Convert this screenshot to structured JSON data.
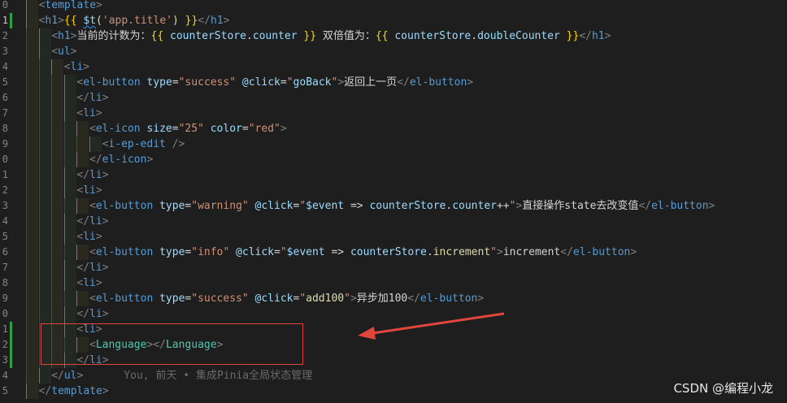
{
  "editor": {
    "line_numbers": [
      "0",
      "1",
      "2",
      "3",
      "4",
      "5",
      "6",
      "7",
      "8",
      "9",
      "0",
      "1",
      "2",
      "3",
      "4",
      "5",
      "6",
      "7",
      "8",
      "9",
      "0",
      "1",
      "2",
      "3",
      "4"
    ],
    "lines": [
      {
        "tokens": [
          [
            "t-punc",
            "<"
          ],
          [
            "t-tag",
            "template"
          ],
          [
            "t-punc",
            ">"
          ]
        ]
      },
      {
        "tokens": [
          [
            "t-punc",
            "<"
          ],
          [
            "t-tag",
            "h1"
          ],
          [
            "t-punc",
            ">"
          ],
          [
            "t-brace",
            "{{ "
          ],
          [
            "t-dollar",
            "$t"
          ],
          [
            "t-fn",
            "("
          ],
          [
            "t-str",
            "'app.title'"
          ],
          [
            "t-fn",
            ")"
          ],
          [
            "t-brace",
            " }}"
          ],
          [
            "t-punc",
            "</"
          ],
          [
            "t-tag",
            "h1"
          ],
          [
            "t-punc",
            ">"
          ]
        ]
      },
      {
        "tokens": [
          [
            "t-punc",
            "<"
          ],
          [
            "t-tag",
            "h1"
          ],
          [
            "t-punc",
            ">"
          ],
          [
            "t-text",
            "当前的计数为："
          ],
          [
            "t-brace",
            "{{ "
          ],
          [
            "t-var",
            "counterStore"
          ],
          [
            "t-op",
            "."
          ],
          [
            "t-var",
            "counter"
          ],
          [
            "t-brace",
            " }}"
          ],
          [
            "t-text",
            " 双倍值为："
          ],
          [
            "t-brace",
            "{{ "
          ],
          [
            "t-var",
            "counterStore"
          ],
          [
            "t-op",
            "."
          ],
          [
            "t-var",
            "doubleCounter"
          ],
          [
            "t-brace",
            " }}"
          ],
          [
            "t-punc",
            "</"
          ],
          [
            "t-tag",
            "h1"
          ],
          [
            "t-punc",
            ">"
          ]
        ]
      },
      {
        "tokens": [
          [
            "t-punc",
            "<"
          ],
          [
            "t-tag",
            "ul"
          ],
          [
            "t-punc",
            ">"
          ]
        ]
      },
      {
        "tokens": [
          [
            "t-punc",
            "<"
          ],
          [
            "t-tag",
            "li"
          ],
          [
            "t-punc",
            ">"
          ]
        ]
      },
      {
        "tokens": [
          [
            "t-punc",
            "<"
          ],
          [
            "t-tag",
            "el-button"
          ],
          [
            "t-text",
            " "
          ],
          [
            "t-attr",
            "type"
          ],
          [
            "t-text",
            "="
          ],
          [
            "t-str",
            "\"success\""
          ],
          [
            "t-text",
            " "
          ],
          [
            "t-attr",
            "@click"
          ],
          [
            "t-text",
            "="
          ],
          [
            "t-str",
            "\""
          ],
          [
            "t-var",
            "goBack"
          ],
          [
            "t-str",
            "\""
          ],
          [
            "t-punc",
            ">"
          ],
          [
            "t-text",
            "返回上一页"
          ],
          [
            "t-punc",
            "</"
          ],
          [
            "t-tag",
            "el-button"
          ],
          [
            "t-punc",
            ">"
          ]
        ]
      },
      {
        "tokens": [
          [
            "t-punc",
            "</"
          ],
          [
            "t-tag",
            "li"
          ],
          [
            "t-punc",
            ">"
          ]
        ]
      },
      {
        "tokens": [
          [
            "t-punc",
            "<"
          ],
          [
            "t-tag",
            "li"
          ],
          [
            "t-punc",
            ">"
          ]
        ]
      },
      {
        "tokens": [
          [
            "t-punc",
            "<"
          ],
          [
            "t-tag",
            "el-icon"
          ],
          [
            "t-text",
            " "
          ],
          [
            "t-attr",
            "size"
          ],
          [
            "t-text",
            "="
          ],
          [
            "t-str",
            "\"25\""
          ],
          [
            "t-text",
            " "
          ],
          [
            "t-attr",
            "color"
          ],
          [
            "t-text",
            "="
          ],
          [
            "t-str",
            "\"red\""
          ],
          [
            "t-punc",
            ">"
          ]
        ]
      },
      {
        "tokens": [
          [
            "t-punc",
            "<"
          ],
          [
            "t-tag",
            "i-ep-edit"
          ],
          [
            "t-text",
            " "
          ],
          [
            "t-punc",
            "/>"
          ]
        ]
      },
      {
        "tokens": [
          [
            "t-punc",
            "</"
          ],
          [
            "t-tag",
            "el-icon"
          ],
          [
            "t-punc",
            ">"
          ]
        ]
      },
      {
        "tokens": [
          [
            "t-punc",
            "</"
          ],
          [
            "t-tag",
            "li"
          ],
          [
            "t-punc",
            ">"
          ]
        ]
      },
      {
        "tokens": [
          [
            "t-punc",
            "<"
          ],
          [
            "t-tag",
            "li"
          ],
          [
            "t-punc",
            ">"
          ]
        ]
      },
      {
        "tokens": [
          [
            "t-punc",
            "<"
          ],
          [
            "t-tag",
            "el-button"
          ],
          [
            "t-text",
            " "
          ],
          [
            "t-attr",
            "type"
          ],
          [
            "t-text",
            "="
          ],
          [
            "t-str",
            "\"warning\""
          ],
          [
            "t-text",
            " "
          ],
          [
            "t-attr",
            "@click"
          ],
          [
            "t-text",
            "="
          ],
          [
            "t-str",
            "\""
          ],
          [
            "t-var",
            "$event"
          ],
          [
            "t-text",
            " => "
          ],
          [
            "t-var",
            "counterStore"
          ],
          [
            "t-op",
            "."
          ],
          [
            "t-var",
            "counter"
          ],
          [
            "t-op",
            "++"
          ],
          [
            "t-str",
            "\""
          ],
          [
            "t-punc",
            ">"
          ],
          [
            "t-text",
            "直接操作state去改变值"
          ],
          [
            "t-punc",
            "</"
          ],
          [
            "t-tag",
            "el-button"
          ],
          [
            "t-punc",
            ">"
          ]
        ]
      },
      {
        "tokens": [
          [
            "t-punc",
            "</"
          ],
          [
            "t-tag",
            "li"
          ],
          [
            "t-punc",
            ">"
          ]
        ]
      },
      {
        "tokens": [
          [
            "t-punc",
            "<"
          ],
          [
            "t-tag",
            "li"
          ],
          [
            "t-punc",
            ">"
          ]
        ]
      },
      {
        "tokens": [
          [
            "t-punc",
            "<"
          ],
          [
            "t-tag",
            "el-button"
          ],
          [
            "t-text",
            " "
          ],
          [
            "t-attr",
            "type"
          ],
          [
            "t-text",
            "="
          ],
          [
            "t-str",
            "\"info\""
          ],
          [
            "t-text",
            " "
          ],
          [
            "t-attr",
            "@click"
          ],
          [
            "t-text",
            "="
          ],
          [
            "t-str",
            "\""
          ],
          [
            "t-var",
            "$event"
          ],
          [
            "t-text",
            " => "
          ],
          [
            "t-var",
            "counterStore"
          ],
          [
            "t-op",
            "."
          ],
          [
            "t-fn",
            "increment"
          ],
          [
            "t-str",
            "\""
          ],
          [
            "t-punc",
            ">"
          ],
          [
            "t-text",
            "increment"
          ],
          [
            "t-punc",
            "</"
          ],
          [
            "t-tag",
            "el-button"
          ],
          [
            "t-punc",
            ">"
          ]
        ]
      },
      {
        "tokens": [
          [
            "t-punc",
            "</"
          ],
          [
            "t-tag",
            "li"
          ],
          [
            "t-punc",
            ">"
          ]
        ]
      },
      {
        "tokens": [
          [
            "t-punc",
            "<"
          ],
          [
            "t-tag",
            "li"
          ],
          [
            "t-punc",
            ">"
          ]
        ]
      },
      {
        "tokens": [
          [
            "t-punc",
            "<"
          ],
          [
            "t-tag",
            "el-button"
          ],
          [
            "t-text",
            " "
          ],
          [
            "t-attr",
            "type"
          ],
          [
            "t-text",
            "="
          ],
          [
            "t-str",
            "\"success\""
          ],
          [
            "t-text",
            " "
          ],
          [
            "t-attr",
            "@click"
          ],
          [
            "t-text",
            "="
          ],
          [
            "t-str",
            "\""
          ],
          [
            "t-fn",
            "add100"
          ],
          [
            "t-str",
            "\""
          ],
          [
            "t-punc",
            ">"
          ],
          [
            "t-text",
            "异步加100"
          ],
          [
            "t-punc",
            "</"
          ],
          [
            "t-tag",
            "el-button"
          ],
          [
            "t-punc",
            ">"
          ]
        ]
      },
      {
        "tokens": [
          [
            "t-punc",
            "</"
          ],
          [
            "t-tag",
            "li"
          ],
          [
            "t-punc",
            ">"
          ]
        ]
      },
      {
        "tokens": [
          [
            "t-punc",
            "<"
          ],
          [
            "t-tag",
            "li"
          ],
          [
            "t-punc",
            ">"
          ]
        ]
      },
      {
        "tokens": [
          [
            "t-punc",
            "<"
          ],
          [
            "t-comp",
            "Language"
          ],
          [
            "t-punc",
            ">"
          ],
          [
            "t-punc",
            "</"
          ],
          [
            "t-comp",
            "Language"
          ],
          [
            "t-punc",
            ">"
          ]
        ]
      },
      {
        "tokens": [
          [
            "t-punc",
            "</"
          ],
          [
            "t-tag",
            "li"
          ],
          [
            "t-punc",
            ">"
          ]
        ]
      },
      {
        "tokens": [
          [
            "t-punc",
            "</"
          ],
          [
            "t-tag",
            "ul"
          ],
          [
            "t-punc",
            ">"
          ]
        ]
      },
      {
        "tokens": [
          [
            "t-punc",
            "</"
          ],
          [
            "t-tag",
            "template"
          ],
          [
            "t-punc",
            ">"
          ]
        ]
      }
    ],
    "blame": "You, 前天 • 集成Pinia全局状态管理",
    "line_number_last": "5"
  },
  "watermark": "CSDN @编程小龙",
  "colors": {
    "background": "#1e1e1e",
    "highlight_box": "#e0463c",
    "arrow": "#e0463c"
  }
}
